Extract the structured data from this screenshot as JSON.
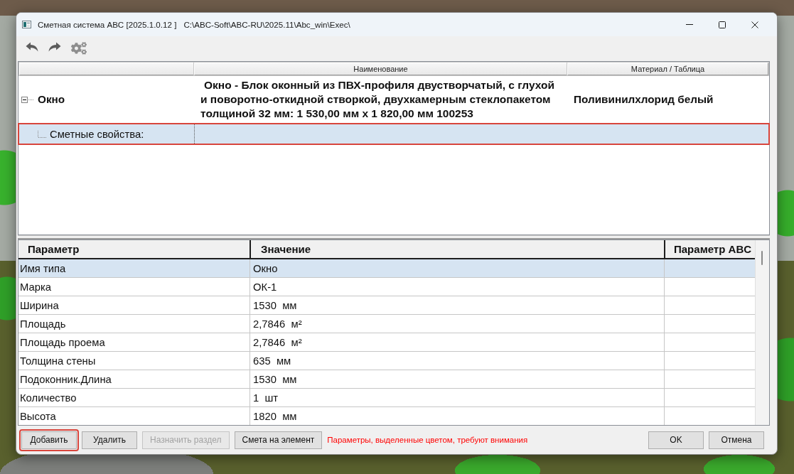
{
  "window": {
    "title": "Сметная система ABC [2025.1.0.12 ]",
    "path": "C:\\ABC-Soft\\ABC-RU\\2025.11\\Abc_win\\Exec\\"
  },
  "tree": {
    "columns": [
      {
        "label": "Наименование"
      },
      {
        "label": "Материал / Таблица"
      }
    ],
    "rows": [
      {
        "name": "Окно",
        "description": "Окно - Блок оконный из ПВХ-профиля двустворчатый, с глухой и поворотно-откидной створкой, двухкамерным стеклопакетом толщиной 32 мм: 1 530,00 мм x 1 820,00 мм 100253",
        "material": "Поливинилхлорид белый",
        "expanded": true,
        "selected": false,
        "highlighted": false,
        "children": [
          {
            "name": "Сметные свойства:",
            "selected": true,
            "highlighted": true
          }
        ]
      }
    ]
  },
  "parameters": {
    "columns": [
      "Параметр",
      "Значение",
      "Параметр ABC"
    ],
    "rows": [
      {
        "parameter": "Имя типа",
        "value": "Окно",
        "selected": true
      },
      {
        "parameter": "Марка",
        "value": "ОК-1",
        "selected": false
      },
      {
        "parameter": "Ширина",
        "value": "1530  мм",
        "selected": false
      },
      {
        "parameter": "Площадь",
        "value": "2,7846  м²",
        "selected": false
      },
      {
        "parameter": "Площадь проема",
        "value": "2,7846  м²",
        "selected": false
      },
      {
        "parameter": "Толщина стены",
        "value": "635  мм",
        "selected": false
      },
      {
        "parameter": "Подоконник.Длина",
        "value": "1530  мм",
        "selected": false
      },
      {
        "parameter": "Количество",
        "value": "1  шт",
        "selected": false
      },
      {
        "parameter": "Высота",
        "value": "1820  мм",
        "selected": false
      }
    ]
  },
  "buttons": [
    {
      "label": "Добавить",
      "disabled": false,
      "highlighted": true
    },
    {
      "label": "Удалить",
      "disabled": false,
      "highlighted": false
    },
    {
      "label": "Назначить раздел",
      "disabled": true,
      "highlighted": false
    },
    {
      "label": "Смета на элемент",
      "disabled": false,
      "highlighted": false
    }
  ],
  "notice": "Параметры, выделенные цветом, требуют внимания",
  "dialog_buttons": [
    {
      "label": "OK",
      "disabled": false,
      "highlighted": false
    },
    {
      "label": "Отмена",
      "disabled": false,
      "highlighted": false
    }
  ]
}
